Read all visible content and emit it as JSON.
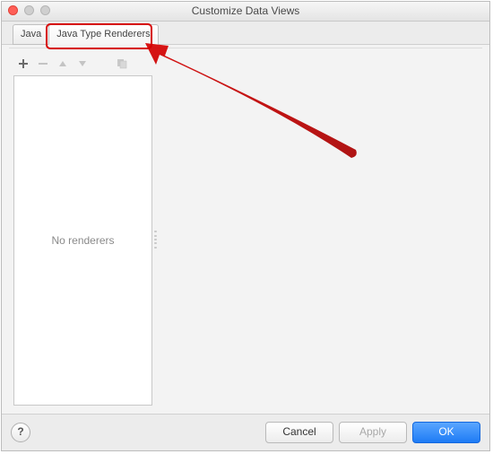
{
  "window": {
    "title": "Customize Data Views"
  },
  "tabs": [
    {
      "label": "Java"
    },
    {
      "label": "Java Type Renderers"
    }
  ],
  "list": {
    "placeholder": "No renderers"
  },
  "buttons": {
    "help": "?",
    "cancel": "Cancel",
    "apply": "Apply",
    "ok": "OK"
  },
  "colors": {
    "annotation": "#d60000",
    "primary": "#1e7bf5"
  }
}
